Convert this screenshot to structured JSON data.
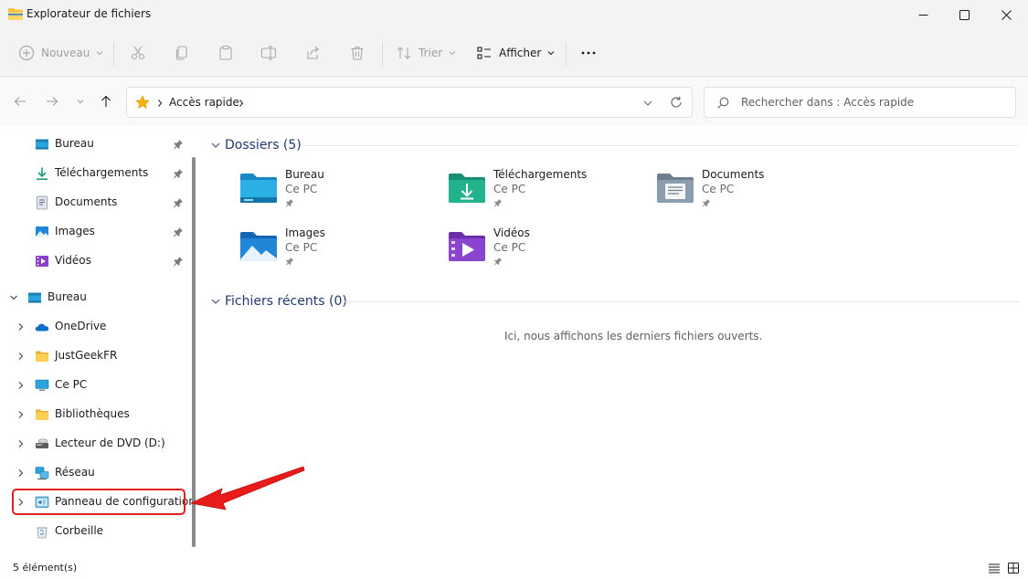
{
  "window": {
    "title": "Explorateur de fichiers"
  },
  "toolbar": {
    "new_label": "Nouveau",
    "sort_label": "Trier",
    "view_label": "Afficher"
  },
  "address": {
    "crumb": "Accès rapide"
  },
  "search": {
    "placeholder": "Rechercher dans : Accès rapide"
  },
  "sidebar": {
    "pinned": [
      {
        "label": "Bureau",
        "icon": "desktop-icon"
      },
      {
        "label": "Téléchargements",
        "icon": "download-icon"
      },
      {
        "label": "Documents",
        "icon": "documents-icon"
      },
      {
        "label": "Images",
        "icon": "images-icon"
      },
      {
        "label": "Vidéos",
        "icon": "videos-icon"
      }
    ],
    "root": {
      "label": "Bureau",
      "icon": "desktop-icon"
    },
    "tree": [
      {
        "label": "OneDrive",
        "icon": "onedrive-icon"
      },
      {
        "label": "JustGeekFR",
        "icon": "folder-icon"
      },
      {
        "label": "Ce PC",
        "icon": "pc-icon"
      },
      {
        "label": "Bibliothèques",
        "icon": "libraries-icon"
      },
      {
        "label": "Lecteur de DVD (D:)",
        "icon": "dvd-icon"
      },
      {
        "label": "Réseau",
        "icon": "network-icon"
      },
      {
        "label": "Panneau de configuration",
        "icon": "control-panel-icon"
      },
      {
        "label": "Corbeille",
        "icon": "recycle-bin-icon"
      }
    ]
  },
  "main": {
    "folders_header": "Dossiers (5)",
    "folders": [
      {
        "name": "Bureau",
        "sub": "Ce PC"
      },
      {
        "name": "Téléchargements",
        "sub": "Ce PC"
      },
      {
        "name": "Documents",
        "sub": "Ce PC"
      },
      {
        "name": "Images",
        "sub": "Ce PC"
      },
      {
        "name": "Vidéos",
        "sub": "Ce PC"
      }
    ],
    "recent_header": "Fichiers récents (0)",
    "recent_empty": "Ici, nous affichons les derniers fichiers ouverts."
  },
  "status": {
    "count": "5 élément(s)"
  },
  "colors": {
    "highlight": "#e02020",
    "header_text": "#1f3a70"
  }
}
